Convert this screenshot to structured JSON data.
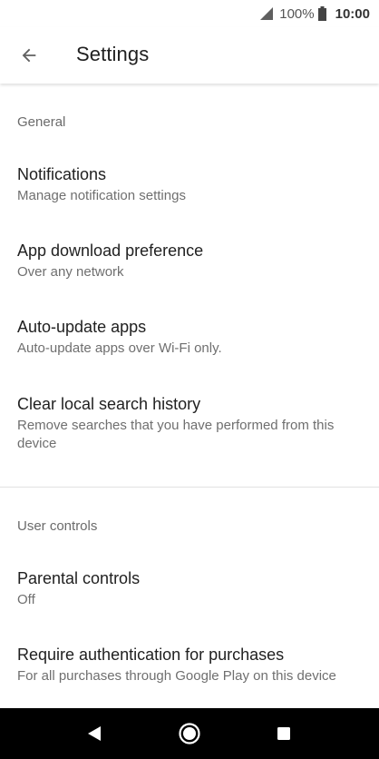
{
  "status_bar": {
    "battery_percent": "100%",
    "time": "10:00",
    "icons": [
      "signal-icon",
      "battery-icon"
    ]
  },
  "app_bar": {
    "title": "Settings",
    "back_icon": "arrow-back-icon"
  },
  "sections": {
    "general": {
      "header": "General",
      "items": [
        {
          "title": "Notifications",
          "subtitle": "Manage notification settings"
        },
        {
          "title": "App download preference",
          "subtitle": "Over any network"
        },
        {
          "title": "Auto-update apps",
          "subtitle": "Auto-update apps over Wi-Fi only."
        },
        {
          "title": "Clear local search history",
          "subtitle": "Remove searches that you have performed from this device"
        }
      ]
    },
    "user_controls": {
      "header": "User controls",
      "items": [
        {
          "title": "Parental controls",
          "subtitle": "Off"
        },
        {
          "title": "Require authentication for purchases",
          "subtitle": "For all purchases through Google Play on this device"
        }
      ]
    }
  },
  "nav_bar": {
    "icons": [
      "back-triangle-icon",
      "home-circle-icon",
      "recents-square-icon"
    ]
  },
  "colors": {
    "background": "#ffffff",
    "nav_bar": "#000000",
    "primary_text": "#212121",
    "secondary_text": "#6f6f6f"
  }
}
